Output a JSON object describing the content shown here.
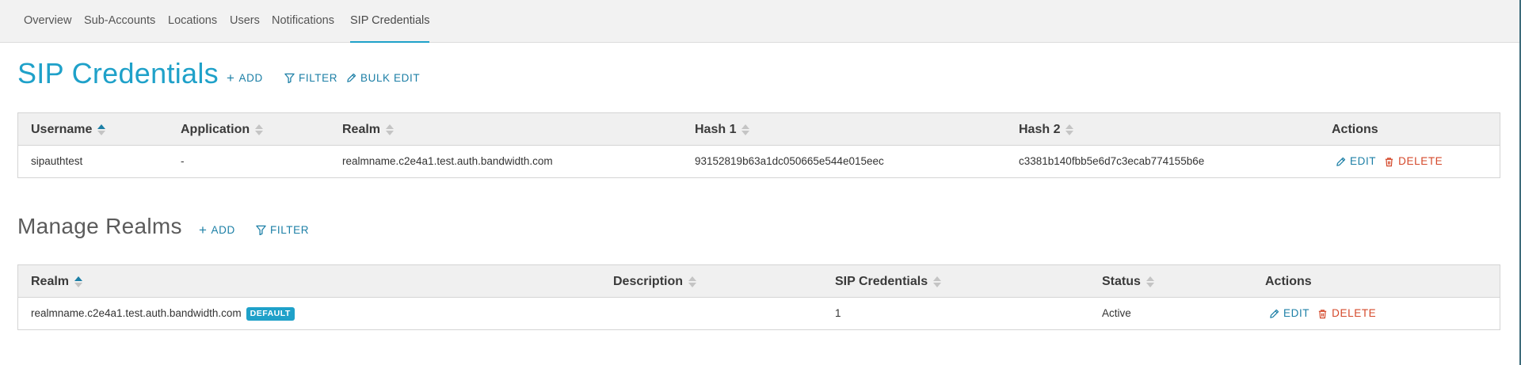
{
  "nav": {
    "tabs": [
      {
        "label": "Overview"
      },
      {
        "label": "Sub-Accounts"
      },
      {
        "label": "Locations"
      },
      {
        "label": "Users"
      },
      {
        "label": "Notifications"
      },
      {
        "label": "SIP Credentials"
      }
    ],
    "active_tab": "SIP Credentials"
  },
  "sip_credentials": {
    "title": "SIP Credentials",
    "actions": {
      "add": "ADD",
      "filter": "FILTER",
      "bulk_edit": "BULK EDIT"
    },
    "columns": [
      "Username",
      "Application",
      "Realm",
      "Hash 1",
      "Hash 2",
      "Actions"
    ],
    "sorted_column": "Username",
    "rows": [
      {
        "username": "sipauthtest",
        "application": "-",
        "realm": "realmname.c2e4a1.test.auth.bandwidth.com",
        "hash1": "93152819b63a1dc050665e544e015eec",
        "hash2": "c3381b140fbb5e6d7c3ecab774155b6e",
        "edit": "EDIT",
        "delete": "DELETE"
      }
    ]
  },
  "realms": {
    "title": "Manage Realms",
    "actions": {
      "add": "ADD",
      "filter": "FILTER"
    },
    "columns": [
      "Realm",
      "Description",
      "SIP Credentials",
      "Status",
      "Actions"
    ],
    "sorted_column": "Realm",
    "rows": [
      {
        "realm": "realmname.c2e4a1.test.auth.bandwidth.com",
        "badge": "DEFAULT",
        "description": "",
        "sip_credentials": "1",
        "status": "Active",
        "edit": "EDIT",
        "delete": "DELETE"
      }
    ]
  },
  "colors": {
    "accent": "#1fa1c9",
    "link": "#1c7fa6",
    "danger": "#d4482a",
    "header_bg": "#f0f0f0"
  }
}
